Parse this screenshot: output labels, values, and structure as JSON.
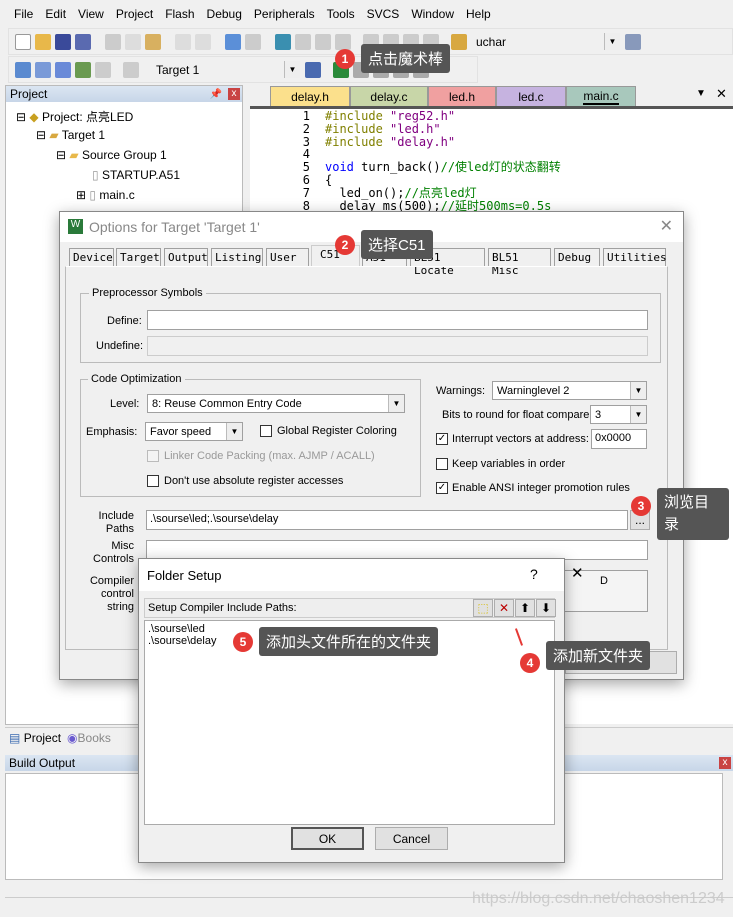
{
  "menu": [
    "File",
    "Edit",
    "View",
    "Project",
    "Flash",
    "Debug",
    "Peripherals",
    "Tools",
    "SVCS",
    "Window",
    "Help"
  ],
  "toolbar": {
    "find_value": "uchar",
    "target": "Target 1"
  },
  "project_pane": {
    "title": "Project",
    "tree": [
      "Project: 点亮LED",
      "Target 1",
      "Source Group 1",
      "STARTUP.A51",
      "main.c"
    ]
  },
  "editor": {
    "tabs": [
      {
        "label": "delay.h",
        "color": "#fbe08c"
      },
      {
        "label": "delay.c",
        "color": "#c8d6a8"
      },
      {
        "label": "led.h",
        "color": "#f0a0a0"
      },
      {
        "label": "led.c",
        "color": "#c6b3e0"
      },
      {
        "label": "main.c",
        "color": "#a8c8bc"
      }
    ],
    "lines": [
      {
        "n": "1",
        "pre": "#include ",
        "str": "\"reg52.h\""
      },
      {
        "n": "2",
        "pre": "#include ",
        "str": "\"led.h\""
      },
      {
        "n": "3",
        "pre": "#include ",
        "str": "\"delay.h\""
      },
      {
        "n": "4"
      },
      {
        "n": "5",
        "kw": "void",
        "txt": " turn_back()",
        "cm": "//使led灯的状态翻转"
      },
      {
        "n": "6",
        "txt": "{"
      },
      {
        "n": "7",
        "txt": "  led_on();",
        "cm": "//点亮led灯"
      },
      {
        "n": "8",
        "txt": "  delay_ms(500);",
        "cm": "//延时500ms=0.5s"
      }
    ]
  },
  "options_dialog": {
    "title": "Options for Target 'Target 1'",
    "tabs": [
      "Device",
      "Target",
      "Output",
      "Listing",
      "User",
      "C51",
      "A51",
      "BL51 Locate",
      "BL51 Misc",
      "Debug",
      "Utilities"
    ],
    "preprocessor": {
      "title": "Preprocessor Symbols",
      "define_label": "Define:",
      "undefine_label": "Undefine:",
      "define": "",
      "undefine": ""
    },
    "code_opt": {
      "title": "Code Optimization",
      "level_label": "Level:",
      "level": "8: Reuse Common Entry Code",
      "emphasis_label": "Emphasis:",
      "emphasis": "Favor speed",
      "global_reg": "Global Register Coloring",
      "linker_packing": "Linker Code Packing (max. AJMP / ACALL)",
      "dont_use_abs": "Don't use absolute register accesses"
    },
    "warnings_label": "Warnings:",
    "warnings": "Warninglevel 2",
    "bits_label": "Bits to round for float compare:",
    "bits": "3",
    "interrupt_label": "Interrupt vectors at address:",
    "interrupt": "0x0000",
    "keep_vars": "Keep variables in order",
    "ansi": "Enable ANSI integer promotion rules",
    "include_label1": "Include",
    "include_label2": "Paths",
    "include_paths": ".\\sourse\\led;.\\sourse\\delay",
    "browse": "...",
    "misc_label1": "Misc",
    "misc_label2": "Controls",
    "ccs_label1": "Compiler",
    "ccs_label2": "control",
    "ccs_label3": "string",
    "ccs_value_tail": "D",
    "help": "Help"
  },
  "folder_dialog": {
    "title": "Folder Setup",
    "help": "?",
    "close": "✕",
    "header": "Setup Compiler Include Paths:",
    "paths": [
      ".\\sourse\\led",
      ".\\sourse\\delay"
    ],
    "ok": "OK",
    "cancel": "Cancel"
  },
  "bottom_tabs": [
    "Project",
    "Books"
  ],
  "build_output": {
    "title": "Build Output"
  },
  "annotations": [
    {
      "n": "1",
      "text": "点击魔术棒"
    },
    {
      "n": "2",
      "text": "选择C51"
    },
    {
      "n": "3",
      "text": "浏览目录"
    },
    {
      "n": "4",
      "text": "添加新文件夹"
    },
    {
      "n": "5",
      "text": "添加头文件所在的文件夹"
    }
  ],
  "watermark": "https://blog.csdn.net/chaoshen1234"
}
